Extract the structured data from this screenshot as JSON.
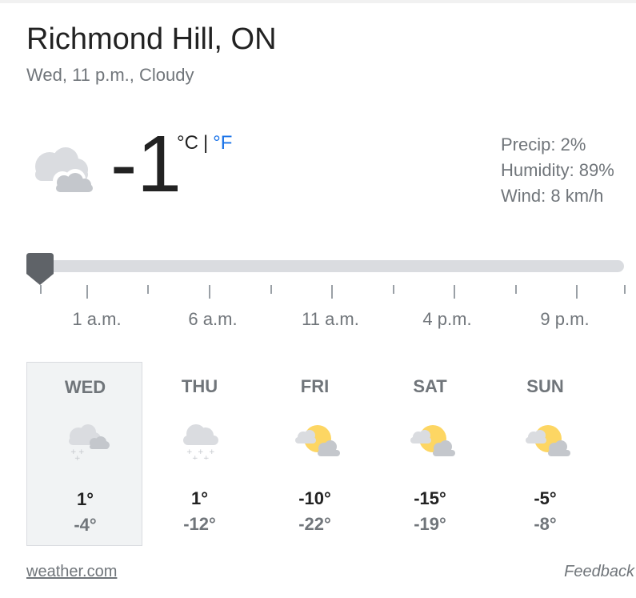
{
  "location": "Richmond Hill, ON",
  "subtitle": "Wed, 11 p.m., Cloudy",
  "current": {
    "icon": "cloudy-icon",
    "temperature": "-1",
    "unit_c": "°C",
    "unit_sep": "|",
    "unit_f": "°F"
  },
  "details": {
    "precip": "Precip: 2%",
    "humidity": "Humidity: 89%",
    "wind": "Wind: 8 km/h"
  },
  "timeline": {
    "slider_position": 0,
    "labels": [
      "1 a.m.",
      "6 a.m.",
      "11 a.m.",
      "4 p.m.",
      "9 p.m."
    ]
  },
  "forecast": [
    {
      "day": "WED",
      "hi": "1°",
      "lo": "-4°",
      "icon": "cloudy-snow-icon",
      "selected": true
    },
    {
      "day": "THU",
      "hi": "1°",
      "lo": "-12°",
      "icon": "snow-icon",
      "selected": false
    },
    {
      "day": "FRI",
      "hi": "-10°",
      "lo": "-22°",
      "icon": "partly-cloudy-icon",
      "selected": false
    },
    {
      "day": "SAT",
      "hi": "-15°",
      "lo": "-19°",
      "icon": "partly-cloudy-icon",
      "selected": false
    },
    {
      "day": "SUN",
      "hi": "-5°",
      "lo": "-8°",
      "icon": "partly-cloudy-icon",
      "selected": false
    }
  ],
  "footer": {
    "source": "weather.com",
    "feedback": "Feedback"
  },
  "colors": {
    "accent": "#1a73e8",
    "sun": "#fdd663",
    "cloud": "#dadce0"
  }
}
